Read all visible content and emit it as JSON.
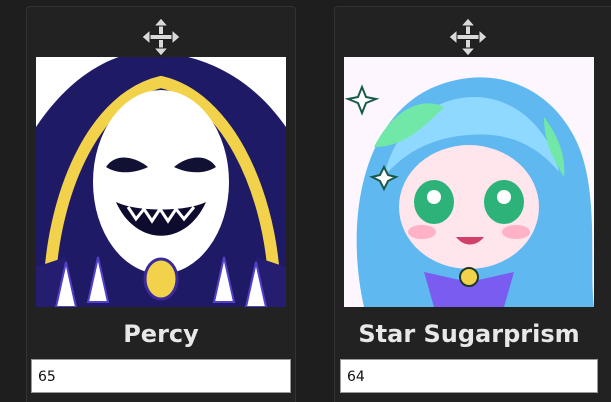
{
  "cards": [
    {
      "name": "Percy",
      "score_value": "65",
      "drag_icon": "move-arrows-icon",
      "portrait_icon": "percy-portrait"
    },
    {
      "name": "Star Sugarprism",
      "score_value": "64",
      "drag_icon": "move-arrows-icon",
      "portrait_icon": "star-sugarprism-portrait"
    }
  ],
  "colors": {
    "background": "#1e1e1e",
    "card": "#222222",
    "text": "#e8e8e8",
    "icon": "#d9d9d9"
  }
}
